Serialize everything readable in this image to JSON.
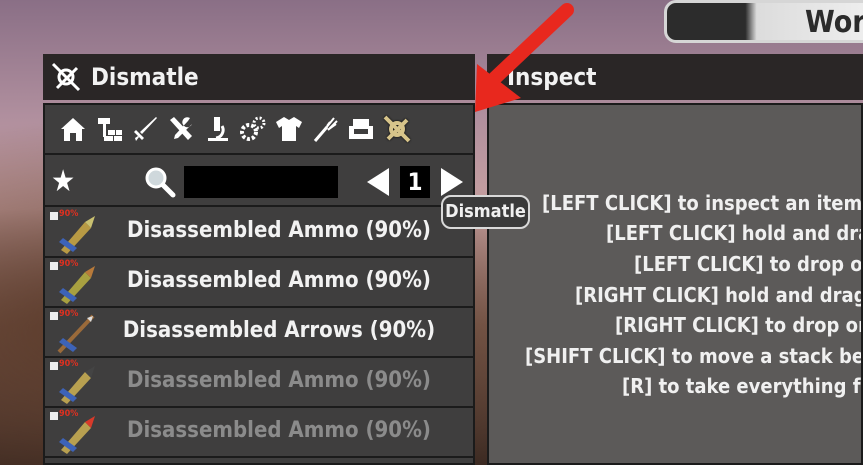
{
  "workbench_tab": {
    "label": "Work"
  },
  "dismantle_panel": {
    "title": "Dismatle",
    "categories": [
      {
        "name": "home"
      },
      {
        "name": "building"
      },
      {
        "name": "weapons"
      },
      {
        "name": "tools"
      },
      {
        "name": "science"
      },
      {
        "name": "parts"
      },
      {
        "name": "clothing"
      },
      {
        "name": "food"
      },
      {
        "name": "furniture"
      },
      {
        "name": "dismantle"
      }
    ],
    "search": {
      "placeholder": "",
      "value": ""
    },
    "page": "1",
    "items": [
      {
        "label": "Disassembled Ammo (90%)",
        "badge": "90%",
        "dim": false
      },
      {
        "label": "Disassembled Ammo (90%)",
        "badge": "90%",
        "dim": false
      },
      {
        "label": "Disassembled Arrows (90%)",
        "badge": "90%",
        "dim": false
      },
      {
        "label": "Disassembled Ammo (90%)",
        "badge": "90%",
        "dim": true
      },
      {
        "label": "Disassembled Ammo (90%)",
        "badge": "90%",
        "dim": true
      }
    ]
  },
  "tooltip": {
    "text": "Dismatle"
  },
  "inspect_panel": {
    "title": "Inspect",
    "help_lines": [
      "[LEFT CLICK] to inspect an item,",
      "[LEFT CLICK] hold and drag",
      "[LEFT CLICK] to drop or",
      "[RIGHT CLICK] hold and drag t",
      "[RIGHT CLICK] to drop on",
      "[SHIFT CLICK] to move a stack bet",
      "[R] to take everything fr"
    ]
  },
  "colors": {
    "accent_arrow": "#e8281e",
    "panel_header": "#2a2626",
    "panel_bg": "#3f3e3e",
    "inspect_bg": "#5c5a59",
    "item_badge": "#e03020"
  }
}
